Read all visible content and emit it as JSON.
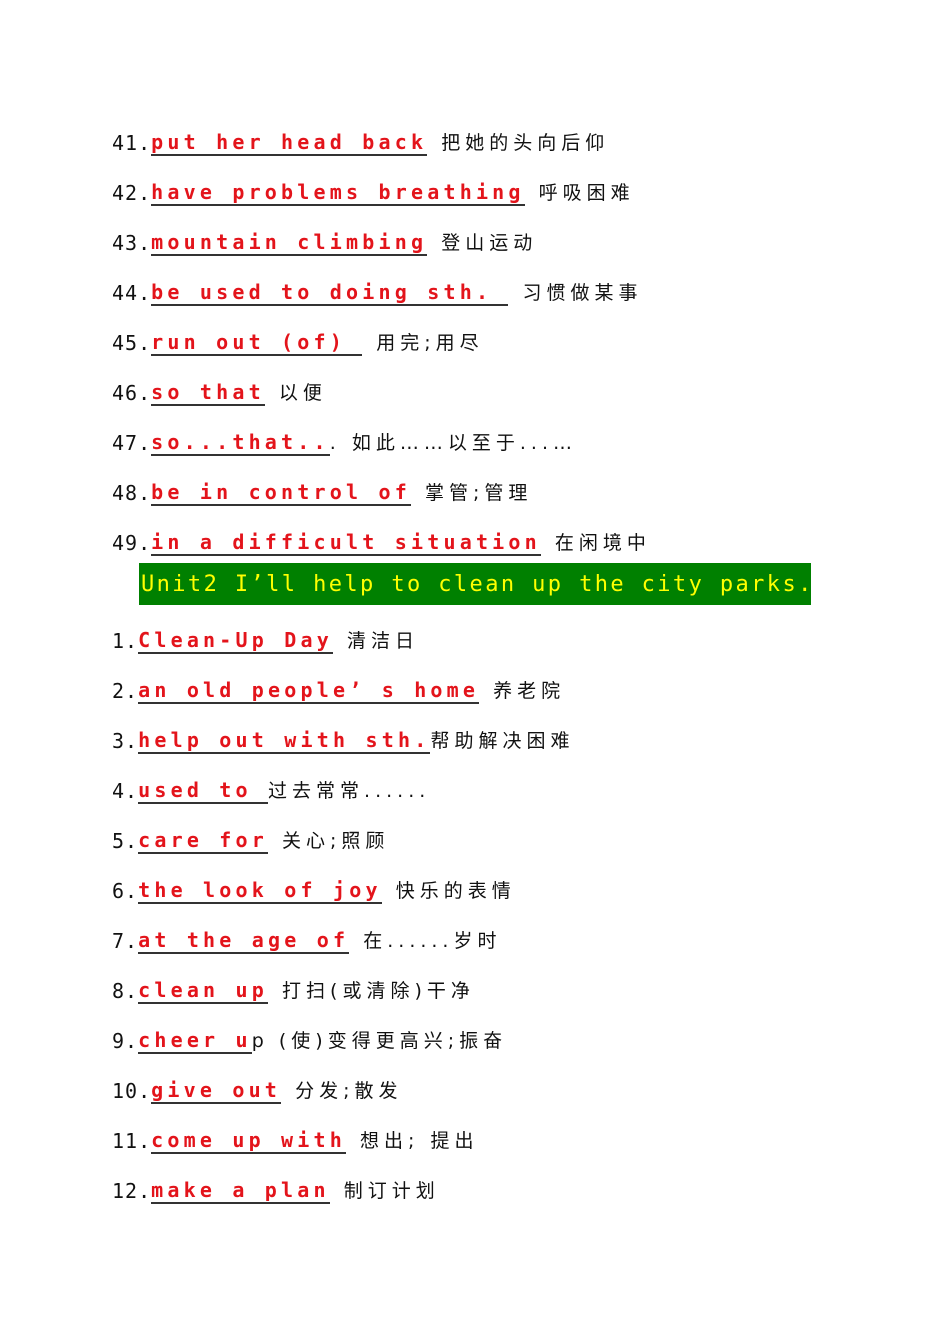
{
  "document": {
    "sections": [
      {
        "items": [
          {
            "number": "41.",
            "phrase": "put her head back",
            "meaning": "把她的头向后仰"
          },
          {
            "number": "42.",
            "phrase": "have problems breathing",
            "meaning": "呼吸困难"
          },
          {
            "number": "43.",
            "phrase": "mountain climbing",
            "meaning": "登山运动"
          },
          {
            "number": "44.",
            "phrase": "be used to doing sth. ",
            "meaning": "习惯做某事"
          },
          {
            "number": "45.",
            "phrase": "run out (of) ",
            "meaning": "用完;用尽"
          },
          {
            "number": "46.",
            "phrase": "so that",
            "meaning": "以便"
          },
          {
            "number": "47.",
            "phrase": "so...that..",
            "meaning": ". 如此……以至于...…"
          },
          {
            "number": "48.",
            "phrase": "be in control of",
            "meaning": "掌管;管理"
          },
          {
            "number": "49.",
            "phrase": "in a difficult situation",
            "meaning": "在闲境中"
          }
        ]
      },
      {
        "heading": "Unit2 I’ll help to clean up the city parks.",
        "heading_colors": {
          "background": "#008000",
          "text": "#ffff00"
        },
        "items": [
          {
            "number": "1.",
            "phrase": "Clean-Up Day",
            "meaning": "清洁日"
          },
          {
            "number": "2.",
            "phrase": "an old people’ s home",
            "meaning": "养老院"
          },
          {
            "number": "3.",
            "phrase": "help out with sth.",
            "meaning": "帮助解决困难"
          },
          {
            "number": "4.",
            "phrase": "used to ",
            "meaning": "过去常常......"
          },
          {
            "number": "5.",
            "phrase": "care for",
            "meaning": "关心;照顾"
          },
          {
            "number": "6.",
            "phrase": "the look of joy",
            "meaning": "快乐的表情"
          },
          {
            "number": "7.",
            "phrase": "at the age of",
            "meaning": "在......岁时"
          },
          {
            "number": "8.",
            "phrase": "clean up",
            "meaning": "打扫(或清除)干净"
          },
          {
            "number": "9.",
            "phrase": "cheer u",
            "phrase_tail": "p",
            "meaning": " (使)变得更高兴;振奋"
          },
          {
            "number": "10.",
            "phrase": "give out",
            "meaning": "分发;散发"
          },
          {
            "number": "11.",
            "phrase": "come up with",
            "meaning": "想出; 提出"
          },
          {
            "number": "12.",
            "phrase": "make a plan",
            "meaning": "制订计划"
          }
        ]
      }
    ],
    "colors": {
      "phrase": "#e3141b",
      "text": "#111111",
      "underline": "#333333"
    }
  }
}
